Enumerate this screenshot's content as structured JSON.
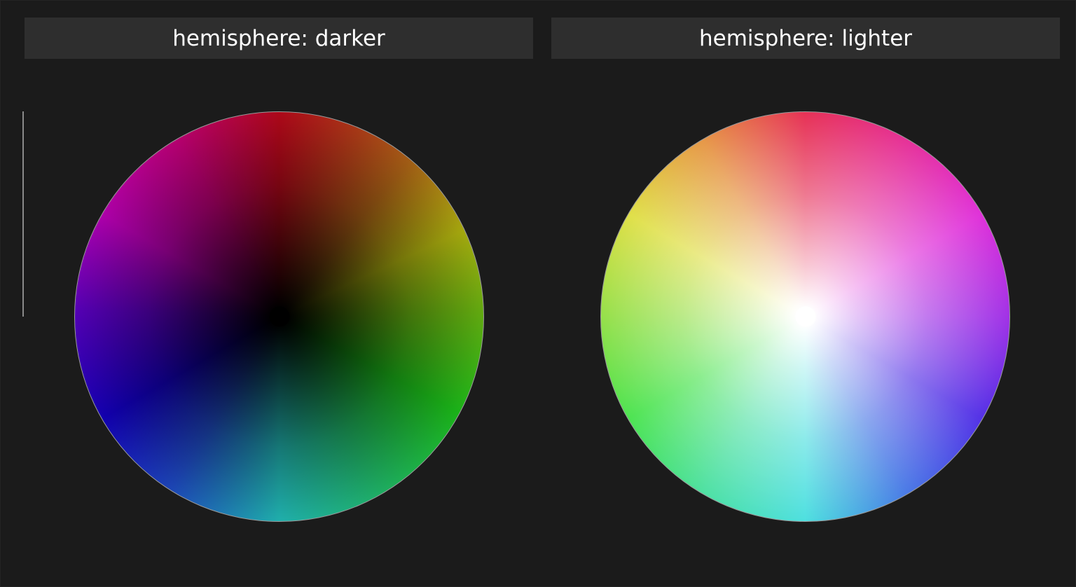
{
  "panels": [
    {
      "title": "hemisphere: darker",
      "wheel": {
        "center_color": "#000000",
        "hue_colors": [
          "#d60a1f",
          "#c8731a",
          "#cdd012",
          "#21dd1e",
          "#27d8d5",
          "#1600d8",
          "#d800d2"
        ]
      }
    },
    {
      "title": "hemisphere: lighter",
      "wheel": {
        "center_color": "#ffffff",
        "hue_colors": [
          "#e0002d",
          "#d800d0",
          "#2a00e0",
          "#24d8d8",
          "#22dd28",
          "#d8d81c",
          "#e07f1c"
        ]
      }
    }
  ],
  "colors": {
    "background": "#1b1b1b",
    "header_background": "#2e2e2e",
    "header_text": "#ffffff",
    "wheel_border": "#9a9a9a"
  }
}
